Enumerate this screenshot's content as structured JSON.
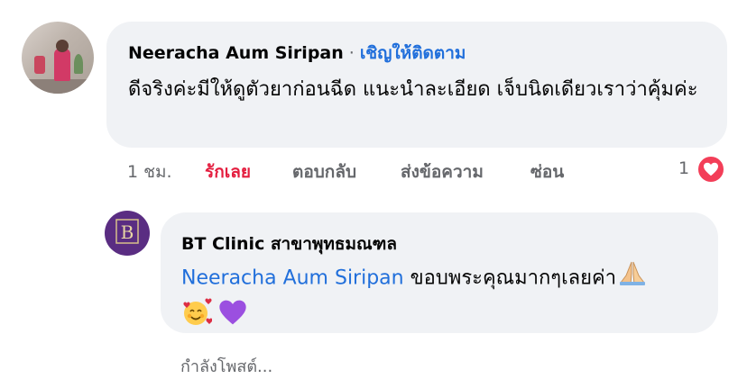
{
  "comment": {
    "author": "Neeracha Aum Siripan",
    "separator": "·",
    "follow_label": "เชิญให้ติดตาม",
    "text": "ดีจริงค่ะมีให้ดูตัวยาก่อนฉีด แนะนำละเอียด เจ็บนิดเดียวเราว่าคุ้มค่ะ"
  },
  "actions": {
    "time": "1 ชม.",
    "like": "รักเลย",
    "reply": "ตอบกลับ",
    "share": "ส่งข้อความ",
    "hide": "ซ่อน"
  },
  "reactions": {
    "count": "1",
    "icon": "heart-icon",
    "color": "#f33e58"
  },
  "reply": {
    "author": "BT Clinic สาขาพุทธมณฑล",
    "avatar_letters": "B",
    "mention": "Neeracha Aum Siripan",
    "text": "ขอบพระคุณมากๆเลยค่า",
    "emojis": [
      "praying-hands-icon",
      "smiling-face-with-hearts-icon",
      "purple-heart-icon"
    ]
  },
  "status": {
    "typing": "กำลังโพสต์..."
  },
  "colors": {
    "link": "#216fdb",
    "love": "#e41e3f",
    "bubble": "#f0f2f5",
    "secondary_text": "#65676b"
  }
}
